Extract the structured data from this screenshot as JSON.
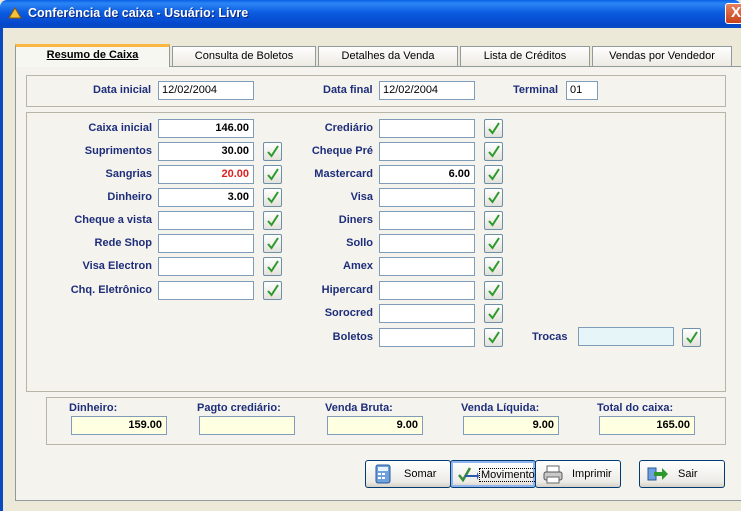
{
  "window": {
    "title": "Conferência de caixa - Usuário: Livre",
    "close_label": "X"
  },
  "tabs": [
    {
      "label": "Resumo de Caixa",
      "active": true
    },
    {
      "label": "Consulta de Boletos"
    },
    {
      "label": "Detalhes da Venda"
    },
    {
      "label": "Lista de Créditos"
    },
    {
      "label": "Vendas por Vendedor"
    }
  ],
  "header": {
    "data_inicial_label": "Data inicial",
    "data_inicial": "12/02/2004",
    "data_final_label": "Data final",
    "data_final": "12/02/2004",
    "terminal_label": "Terminal",
    "terminal": "01"
  },
  "left_fields": [
    {
      "label": "Caixa inicial",
      "value": "146.00"
    },
    {
      "label": "Suprimentos",
      "value": "30.00"
    },
    {
      "label": "Sangrias",
      "value": "20.00"
    },
    {
      "label": "Dinheiro",
      "value": "3.00"
    },
    {
      "label": "Cheque a vista",
      "value": ""
    },
    {
      "label": "Rede Shop",
      "value": ""
    },
    {
      "label": "Visa Electron",
      "value": ""
    },
    {
      "label": "Chq. Eletrônico",
      "value": ""
    }
  ],
  "right_fields": [
    {
      "label": "Crediário",
      "value": ""
    },
    {
      "label": "Cheque Pré",
      "value": ""
    },
    {
      "label": "Mastercard",
      "value": "6.00"
    },
    {
      "label": "Visa",
      "value": ""
    },
    {
      "label": "Diners",
      "value": ""
    },
    {
      "label": "Sollo",
      "value": ""
    },
    {
      "label": "Amex",
      "value": ""
    },
    {
      "label": "Hipercard",
      "value": ""
    },
    {
      "label": "Sorocred",
      "value": ""
    },
    {
      "label": "Boletos",
      "value": ""
    }
  ],
  "trocas": {
    "label": "Trocas",
    "value": ""
  },
  "totals": [
    {
      "label": "Dinheiro:",
      "value": "159.00"
    },
    {
      "label": "Pagto crediário:",
      "value": ""
    },
    {
      "label": "Venda Bruta:",
      "value": "9.00"
    },
    {
      "label": "Venda Líquida:",
      "value": "9.00"
    },
    {
      "label": "Total do caixa:",
      "value": "165.00"
    }
  ],
  "buttons": {
    "somar": "Somar",
    "movimento": "Movimento",
    "imprimir": "Imprimir",
    "sair": "Sair"
  },
  "colors": {
    "sangrias_value": "#E02020",
    "label_blue": "#1E2E7A",
    "check_green": "#2E9A2E"
  }
}
